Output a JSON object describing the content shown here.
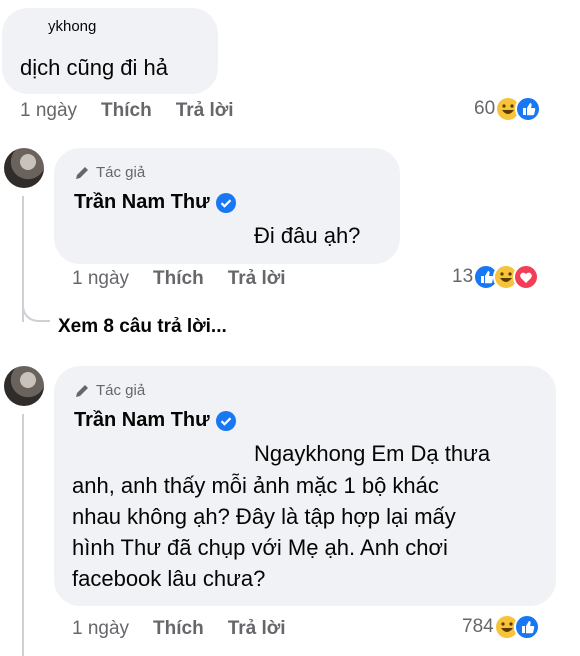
{
  "comment1": {
    "partial_top": "ykhong",
    "text": "dịch cũng đi hả",
    "time": "1 ngày",
    "like_label": "Thích",
    "reply_label": "Trả lời",
    "reaction_count": "60",
    "reactions": [
      "haha",
      "like"
    ]
  },
  "reply1": {
    "author_badge": "Tác giả",
    "author_name": "Trần Nam Thư",
    "text": "Đi đâu ạh?",
    "time": "1 ngày",
    "like_label": "Thích",
    "reply_label": "Trả lời",
    "reaction_count": "13",
    "reactions": [
      "like",
      "haha",
      "love"
    ]
  },
  "see_more_replies": "Xem 8 câu trả lời...",
  "reply2": {
    "author_badge": "Tác giả",
    "author_name": "Trần Nam Thư",
    "line1": "Ngaykhong Em Dạ thưa",
    "line2": "anh, anh thấy mỗi ảnh mặc 1 bộ khác",
    "line3": "nhau không ạh? Đây là tập hợp lại mấy",
    "line4": "hình Thư đã chụp với Mẹ ạh. Anh chơi",
    "line5": "facebook lâu chưa?",
    "time": "1 ngày",
    "like_label": "Thích",
    "reply_label": "Trả lời",
    "reaction_count": "784",
    "reactions": [
      "haha",
      "like"
    ]
  },
  "colors": {
    "bubble": "#f0f2f5",
    "meta_text": "#65676b",
    "like_blue": "#1877f2",
    "haha_yellow": "#f7c33b",
    "love_red": "#f33e58"
  }
}
